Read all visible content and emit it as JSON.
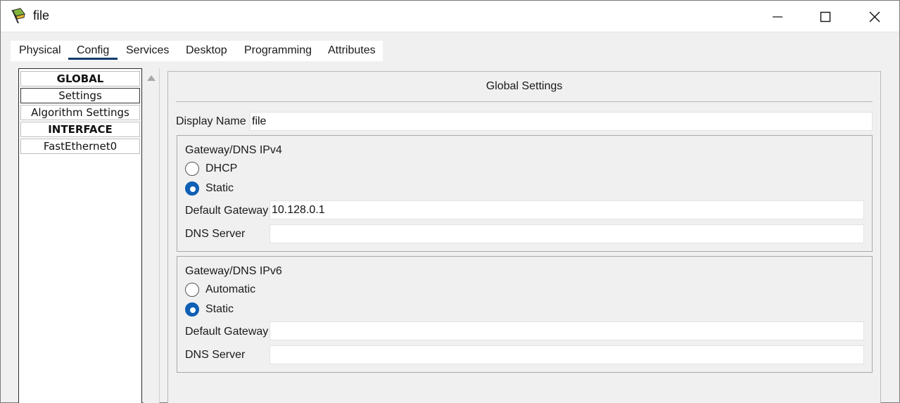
{
  "window": {
    "title": "file"
  },
  "tabs": [
    {
      "label": "Physical"
    },
    {
      "label": "Config"
    },
    {
      "label": "Services"
    },
    {
      "label": "Desktop"
    },
    {
      "label": "Programming"
    },
    {
      "label": "Attributes"
    }
  ],
  "active_tab": "Config",
  "sidebar": {
    "items": [
      {
        "label": "GLOBAL",
        "header": true
      },
      {
        "label": "Settings",
        "selected": true
      },
      {
        "label": "Algorithm Settings"
      },
      {
        "label": "INTERFACE",
        "header": true
      },
      {
        "label": "FastEthernet0"
      }
    ]
  },
  "global_settings": {
    "title": "Global Settings",
    "display_name_label": "Display Name",
    "display_name_value": "file",
    "ipv4": {
      "group_label": "Gateway/DNS IPv4",
      "option_dhcp": "DHCP",
      "option_static": "Static",
      "selected": "Static",
      "gateway_label": "Default Gateway",
      "gateway_value": "10.128.0.1",
      "dns_label": "DNS Server",
      "dns_value": ""
    },
    "ipv6": {
      "group_label": "Gateway/DNS IPv6",
      "option_auto": "Automatic",
      "option_static": "Static",
      "selected": "Static",
      "gateway_label": "Default Gateway",
      "gateway_value": "",
      "dns_label": "DNS Server",
      "dns_value": ""
    }
  },
  "colors": {
    "accent": "#0f5fb4",
    "tab_underline": "#0b3a6e"
  }
}
